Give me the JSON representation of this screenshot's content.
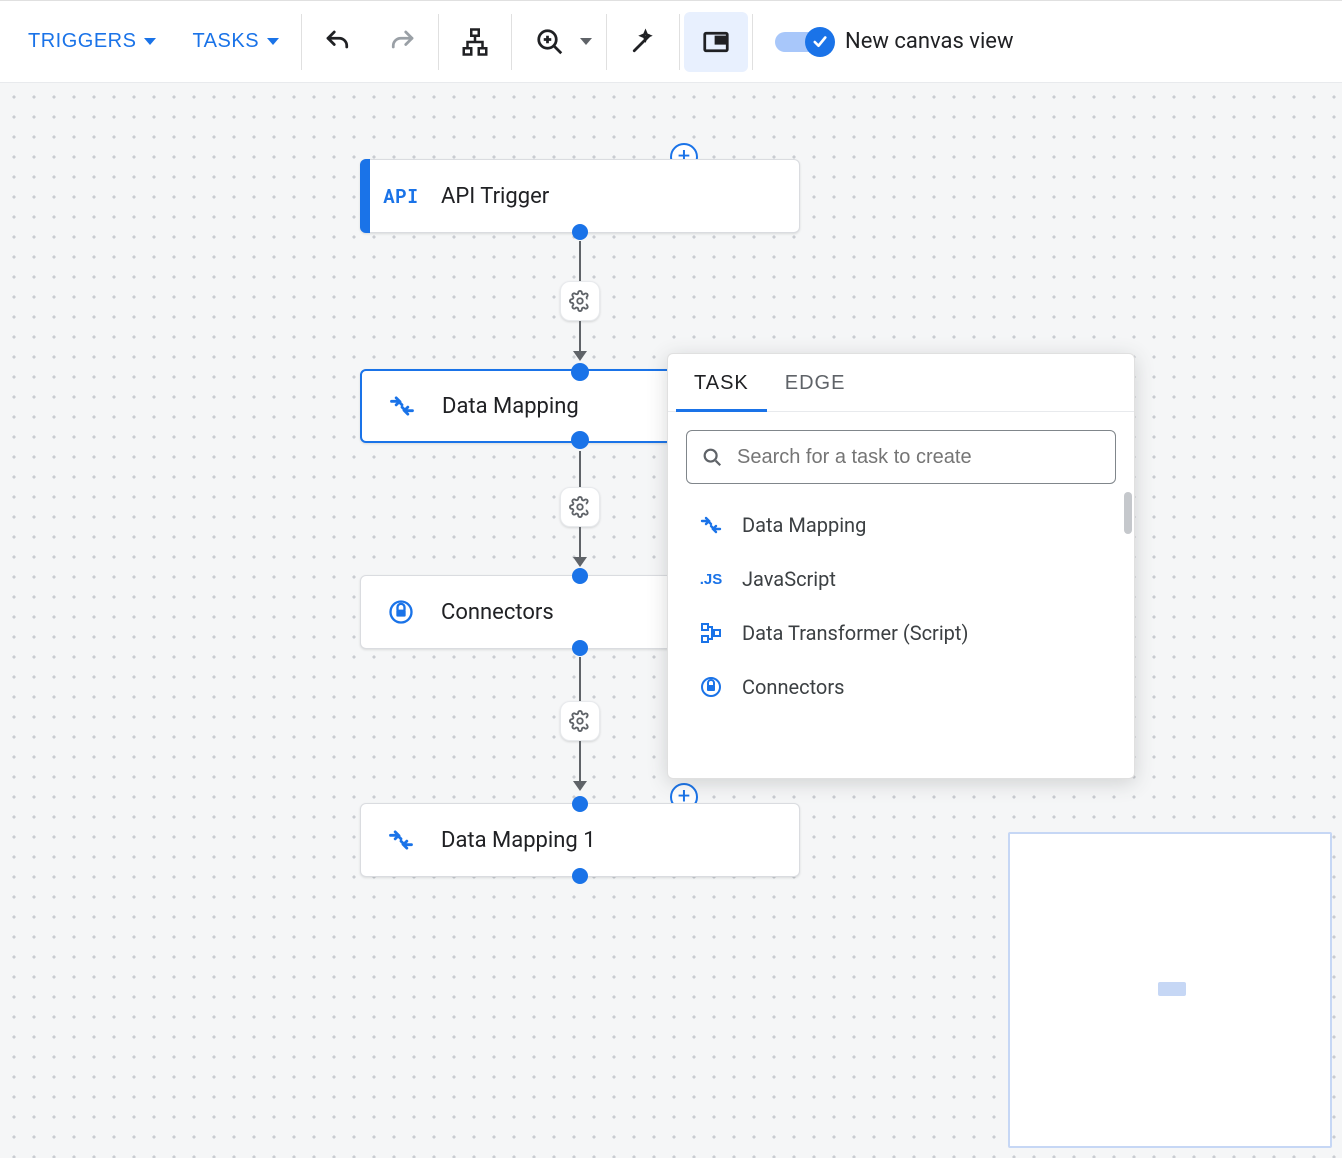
{
  "toolbar": {
    "triggers_label": "TRIGGERS",
    "tasks_label": "TASKS",
    "toggle_label": "New canvas view"
  },
  "nodes": {
    "api_trigger": {
      "label": "API Trigger",
      "icon_text": "API"
    },
    "data_mapping": {
      "label": "Data Mapping"
    },
    "connectors": {
      "label": "Connectors"
    },
    "data_mapping_1": {
      "label": "Data Mapping 1"
    }
  },
  "task_panel": {
    "tabs": {
      "task": "TASK",
      "edge": "EDGE"
    },
    "search_placeholder": "Search for a task to create",
    "items": {
      "data_mapping": "Data Mapping",
      "javascript": "JavaScript",
      "data_transformer": "Data Transformer (Script)",
      "connectors": "Connectors"
    }
  }
}
